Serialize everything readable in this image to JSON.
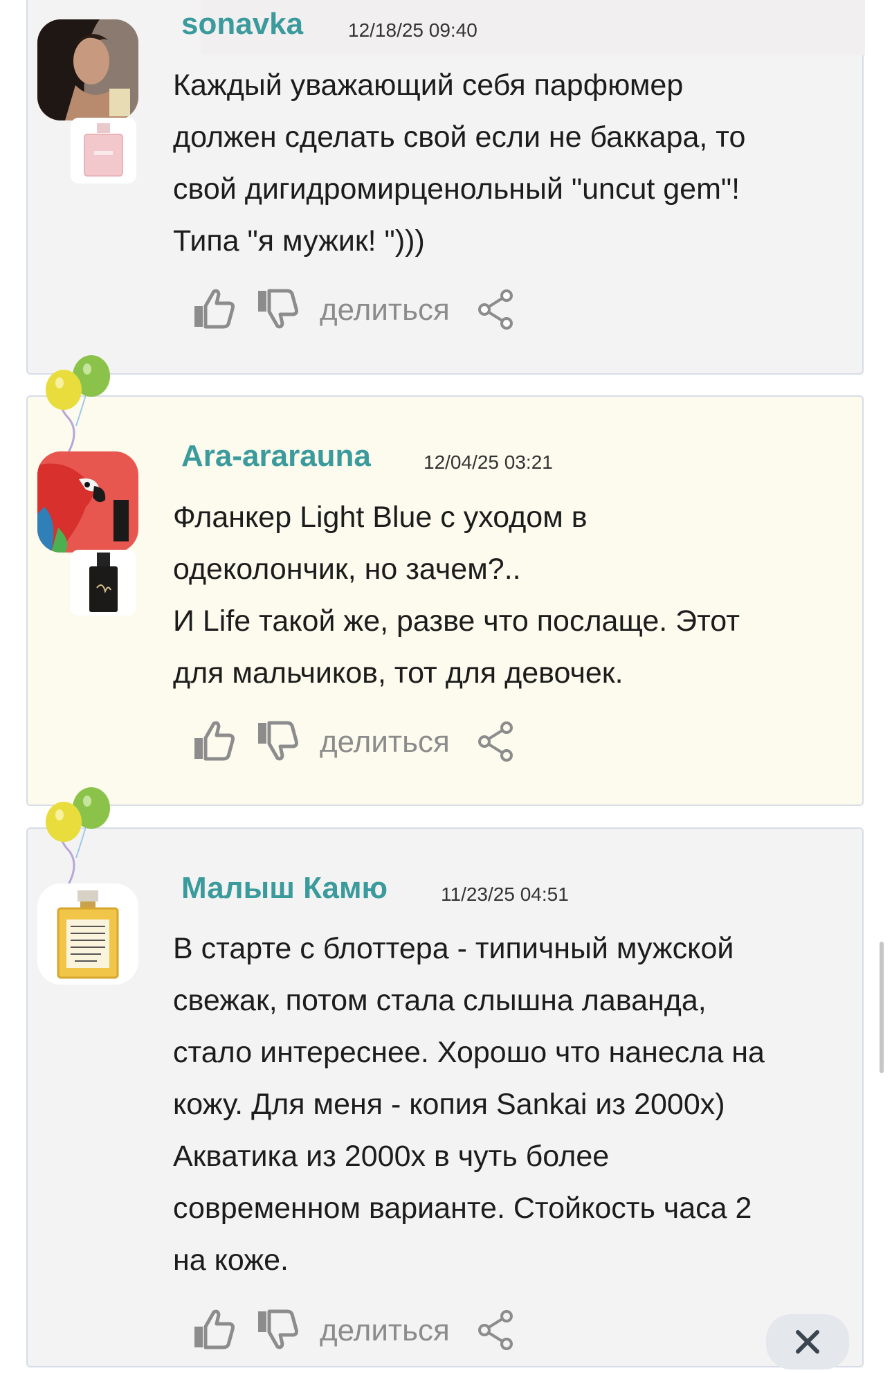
{
  "comments": [
    {
      "username": "sonavka",
      "date": "12/18/25 09:40",
      "text": "Каждый уважающий себя парфюмер\nдолжен сделать свой если не баккара, то\nсвой дигидромирценольный \"uncut gem\"!\nТипа \"я мужик! \")))",
      "share_label": "делиться",
      "avatar_icon": "woman-portrait-avatar",
      "perfume_icon": "pink-perfume-bottle"
    },
    {
      "username": "Ara-ararauna",
      "date": "12/04/25 03:21",
      "text": "Фланкер Light Blue с уходом в\nодеколончик, но зачем?..\nИ Life такой же, разве что послаще. Этот\nдля мальчиков, тот для девочек.",
      "share_label": "делиться",
      "avatar_icon": "parrot-avatar",
      "perfume_icon": "black-perfume-bottle"
    },
    {
      "username": "Малыш Камю",
      "date": "11/23/25 04:51",
      "text": "В старте с блоттера - типичный мужской\nсвежак, потом стала слышна лаванда,\nстало интереснее. Хорошо что нанесла на\nкожу. Для меня - копия Sankai из 2000х)\nАкватика из 2000х в чуть более\nсовременном варианте. Стойкость часа 2\nна коже.",
      "share_label": "делиться",
      "avatar_icon": "yellow-perfume-bottle-avatar"
    }
  ],
  "icons": {
    "like": "thumbs-up-icon",
    "dislike": "thumbs-down-icon",
    "share": "share-icon",
    "close": "close-icon",
    "balloons": "balloons-icon"
  },
  "colors": {
    "username": "#3a9a9c",
    "card_gray": "#f4f3f3",
    "card_cream": "#fcfbee",
    "card_border": "#d6dde6",
    "icon_gray": "#8c8c8c"
  }
}
